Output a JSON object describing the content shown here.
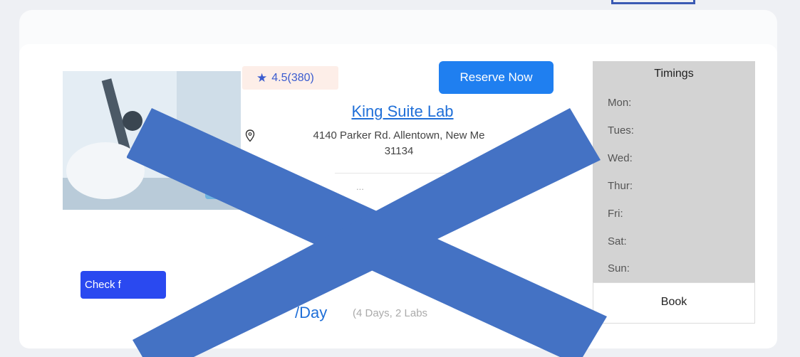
{
  "rating": {
    "icon": "star-icon",
    "text": "4.5(380)"
  },
  "reserve_button": {
    "label": "Reserve Now"
  },
  "lab": {
    "name": "King Suite Lab",
    "address_line1": "4140 Parker Rd. Allentown, New Me",
    "address_line2": "31134"
  },
  "partial_hidden_text": "...",
  "check_button": {
    "label": "Check f"
  },
  "price": {
    "unit": "/Day",
    "note": "(4 Days, 2 Labs"
  },
  "timings": {
    "title": "Timings",
    "days": [
      "Mon:",
      "Tues:",
      "Wed:",
      "Thur:",
      "Fri:",
      "Sat:",
      "Sun:"
    ],
    "book_label": "Book"
  },
  "colors": {
    "accent_blue": "#1f7ff0",
    "link_blue": "#1f6fd8",
    "overlay_x": "#4472c4",
    "timings_bg": "#d3d3d3"
  }
}
